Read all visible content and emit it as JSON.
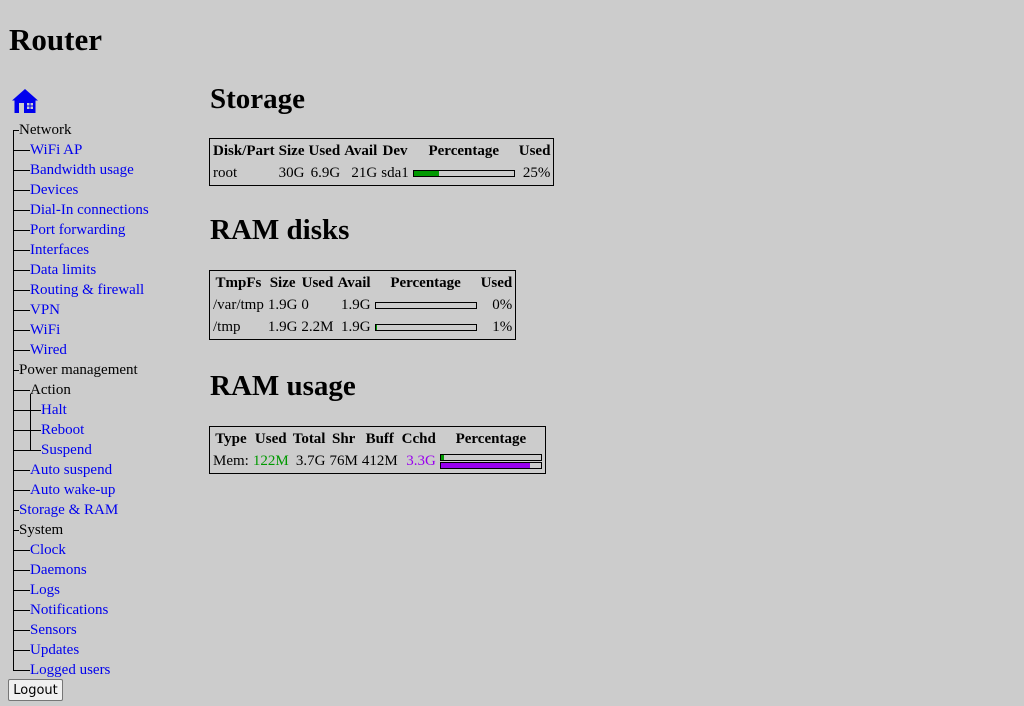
{
  "app": {
    "title": "Router"
  },
  "colors": {
    "link": "#0000ee",
    "used": "#009900",
    "cached": "#9900ee"
  },
  "nav": {
    "home_icon": "home-icon",
    "items": [
      {
        "label": "Network",
        "level": 0,
        "link": false
      },
      {
        "label": "WiFi AP",
        "level": 1,
        "link": true
      },
      {
        "label": "Bandwidth usage",
        "level": 1,
        "link": true
      },
      {
        "label": "Devices",
        "level": 1,
        "link": true
      },
      {
        "label": "Dial-In connections",
        "level": 1,
        "link": true
      },
      {
        "label": "Port forwarding",
        "level": 1,
        "link": true
      },
      {
        "label": "Interfaces",
        "level": 1,
        "link": true
      },
      {
        "label": "Data limits",
        "level": 1,
        "link": true
      },
      {
        "label": "Routing & firewall",
        "level": 1,
        "link": true
      },
      {
        "label": "VPN",
        "level": 1,
        "link": true
      },
      {
        "label": "WiFi",
        "level": 1,
        "link": true
      },
      {
        "label": "Wired",
        "level": 1,
        "link": true
      },
      {
        "label": "Power management",
        "level": 0,
        "link": false
      },
      {
        "label": "Action",
        "level": 1,
        "link": false
      },
      {
        "label": "Halt",
        "level": 2,
        "link": true
      },
      {
        "label": "Reboot",
        "level": 2,
        "link": true
      },
      {
        "label": "Suspend",
        "level": 2,
        "link": true
      },
      {
        "label": "Auto suspend",
        "level": 1,
        "link": true
      },
      {
        "label": "Auto wake-up",
        "level": 1,
        "link": true
      },
      {
        "label": "Storage & RAM",
        "level": 0,
        "link": true
      },
      {
        "label": "System",
        "level": 0,
        "link": false
      },
      {
        "label": "Clock",
        "level": 1,
        "link": true
      },
      {
        "label": "Daemons",
        "level": 1,
        "link": true
      },
      {
        "label": "Logs",
        "level": 1,
        "link": true
      },
      {
        "label": "Notifications",
        "level": 1,
        "link": true
      },
      {
        "label": "Sensors",
        "level": 1,
        "link": true
      },
      {
        "label": "Updates",
        "level": 1,
        "link": true
      },
      {
        "label": "Logged users",
        "level": 1,
        "link": true
      }
    ],
    "logout_label": "Logout"
  },
  "storage": {
    "heading": "Storage",
    "headers": [
      "Disk/Part",
      "Size",
      "Used",
      "Avail",
      "Dev",
      "Percentage",
      "Used"
    ],
    "rows": [
      {
        "name": "root",
        "size": "30G",
        "used": "6.9G",
        "avail": "21G",
        "dev": "sda1",
        "percent": 25,
        "used_pct": "25%"
      }
    ]
  },
  "ramdisks": {
    "heading": "RAM disks",
    "headers": [
      "TmpFs",
      "Size",
      "Used",
      "Avail",
      "Percentage",
      "Used"
    ],
    "rows": [
      {
        "name": "/var/tmp",
        "size": "1.9G",
        "used": "0",
        "avail": "1.9G",
        "percent": 0,
        "used_pct": "0%"
      },
      {
        "name": "/tmp",
        "size": "1.9G",
        "used": "2.2M",
        "avail": "1.9G",
        "percent": 1,
        "used_pct": "1%"
      }
    ]
  },
  "ramusage": {
    "heading": "RAM usage",
    "headers": [
      "Type",
      "Used",
      "Total",
      "Shr",
      "Buff",
      "Cchd",
      "Percentage"
    ],
    "rows": [
      {
        "type": "Mem:",
        "used": "122M",
        "total": "3.7G",
        "shr": "76M",
        "buff": "412M",
        "cchd": "3.3G",
        "used_percent": 3,
        "cached_percent": 89
      }
    ]
  }
}
